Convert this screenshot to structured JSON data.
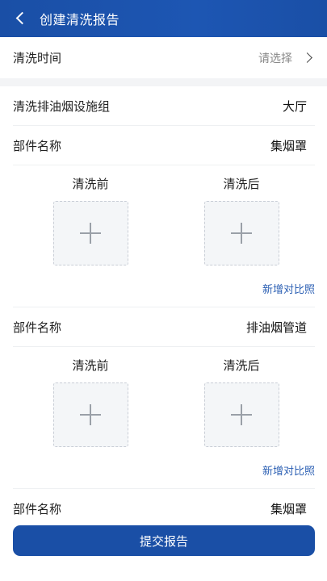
{
  "header": {
    "title": "创建清洗报告"
  },
  "time_row": {
    "label": "清洗时间",
    "placeholder": "请选择"
  },
  "facility": {
    "label": "清洗排油烟设施组",
    "value": "大厅"
  },
  "components": [
    {
      "name_label": "部件名称",
      "name_value": "集烟罩",
      "before_label": "清洗前",
      "after_label": "清洗后",
      "add_label": "新增对比照"
    },
    {
      "name_label": "部件名称",
      "name_value": "排油烟管道",
      "before_label": "清洗前",
      "after_label": "清洗后",
      "add_label": "新增对比照"
    },
    {
      "name_label": "部件名称",
      "name_value": "集烟罩"
    }
  ],
  "submit": {
    "label": "提交报告"
  },
  "colors": {
    "primary": "#1a4fa6",
    "link": "#2b5fb3"
  }
}
